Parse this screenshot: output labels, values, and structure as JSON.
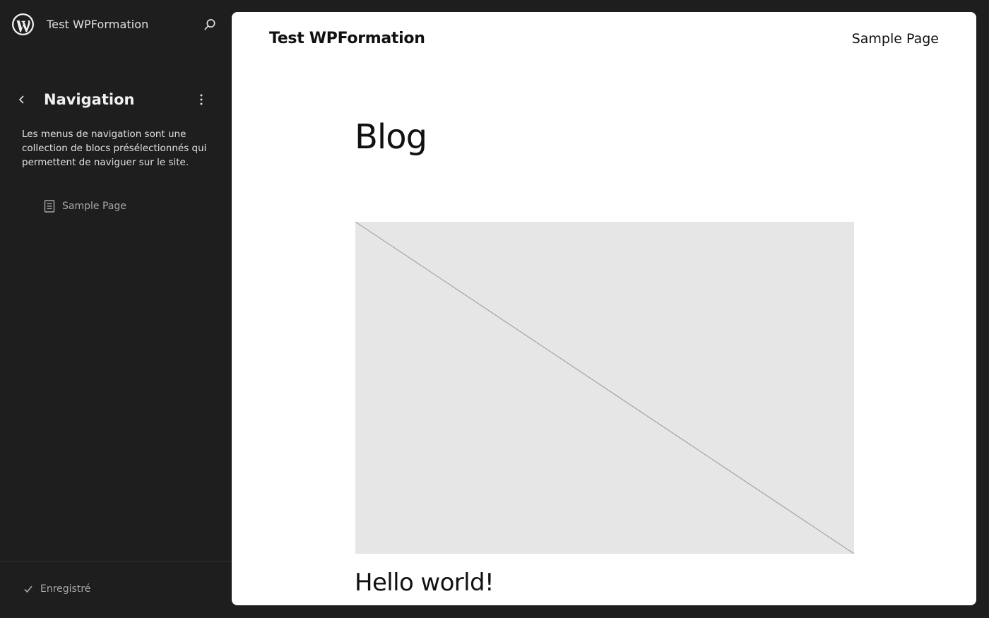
{
  "sidebar": {
    "site_title": "Test WPFormation",
    "navigation": {
      "title": "Navigation",
      "description": "Les menus de navigation sont une collection de blocs présélectionnés qui permettent de naviguer sur le site.",
      "items": [
        {
          "label": "Sample Page",
          "icon": "page-icon"
        }
      ]
    },
    "footer": {
      "status": "Enregistré",
      "icon": "check-icon"
    }
  },
  "canvas": {
    "site_title": "Test WPFormation",
    "nav_link": "Sample Page",
    "page_title": "Blog",
    "post_title": "Hello world!"
  },
  "colors": {
    "sidebar_bg": "#1e1e1e",
    "canvas_bg": "#ffffff",
    "placeholder_bg": "#e6e6e6",
    "muted_text": "#a7a7a7"
  }
}
